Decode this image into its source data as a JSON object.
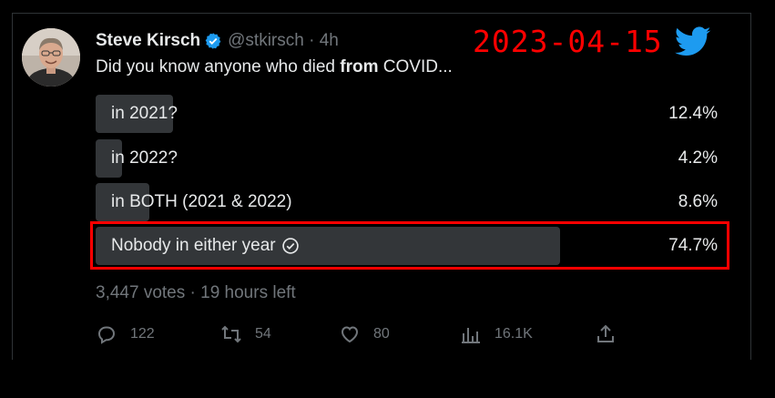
{
  "tweet": {
    "author_name": "Steve Kirsch",
    "handle_time": "@stkirsch · 4h",
    "question_prefix": "Did you know anyone who died ",
    "question_bold": "from",
    "question_suffix": " COVID..."
  },
  "overlay": {
    "date": "2023-04-15",
    "highlight_color": "#ff0000"
  },
  "poll": {
    "options": [
      {
        "label": "in 2021?",
        "percent_label": "12.4%",
        "percent": 12.4
      },
      {
        "label": "in 2022?",
        "percent_label": "4.2%",
        "percent": 4.2
      },
      {
        "label": "in BOTH (2021 & 2022)",
        "percent_label": "8.6%",
        "percent": 8.6
      },
      {
        "label": "Nobody in either year",
        "percent_label": "74.7%",
        "percent": 74.7,
        "winner": true
      }
    ],
    "meta": "3,447 votes · 19 hours left"
  },
  "actions": {
    "replies": "122",
    "retweets": "54",
    "likes": "80",
    "views": "16.1K"
  },
  "icons": [
    "avatar",
    "verified-badge-icon",
    "twitter-bird-icon",
    "check-circle-icon",
    "reply-icon",
    "retweet-icon",
    "like-icon",
    "views-icon",
    "share-icon"
  ],
  "colors": {
    "background": "#000000",
    "text": "#e7e9ea",
    "muted": "#71767b",
    "bar": "#333639",
    "verified": "#1d9bf0",
    "bird": "#1d9bf0",
    "date": "#ff0000"
  }
}
